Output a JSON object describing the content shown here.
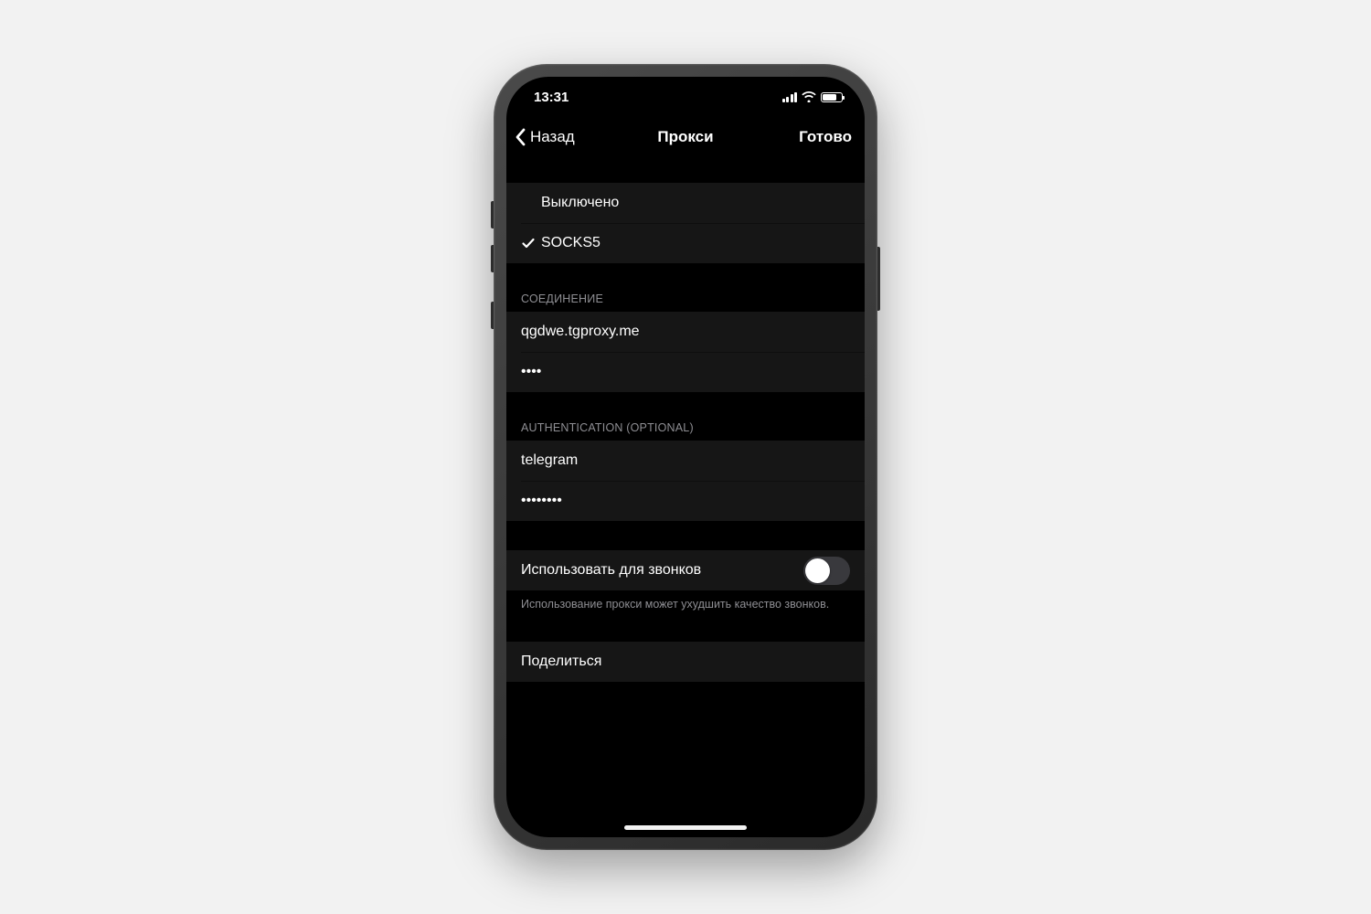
{
  "status": {
    "time": "13:31"
  },
  "nav": {
    "back": "Назад",
    "title": "Прокси",
    "done": "Готово"
  },
  "proxyType": {
    "disabled": "Выключено",
    "socks5": "SOCKS5",
    "selected": "socks5"
  },
  "connection": {
    "header": "СОЕДИНЕНИЕ",
    "server": "qgdwe.tgproxy.me",
    "port_masked": "••••"
  },
  "auth": {
    "header": "AUTHENTICATION (OPTIONAL)",
    "username": "telegram",
    "password_masked": "••••••••"
  },
  "calls": {
    "label": "Использовать для звонков",
    "enabled": false,
    "note": "Использование прокси может ухудшить качество звонков."
  },
  "share": {
    "label": "Поделиться"
  }
}
